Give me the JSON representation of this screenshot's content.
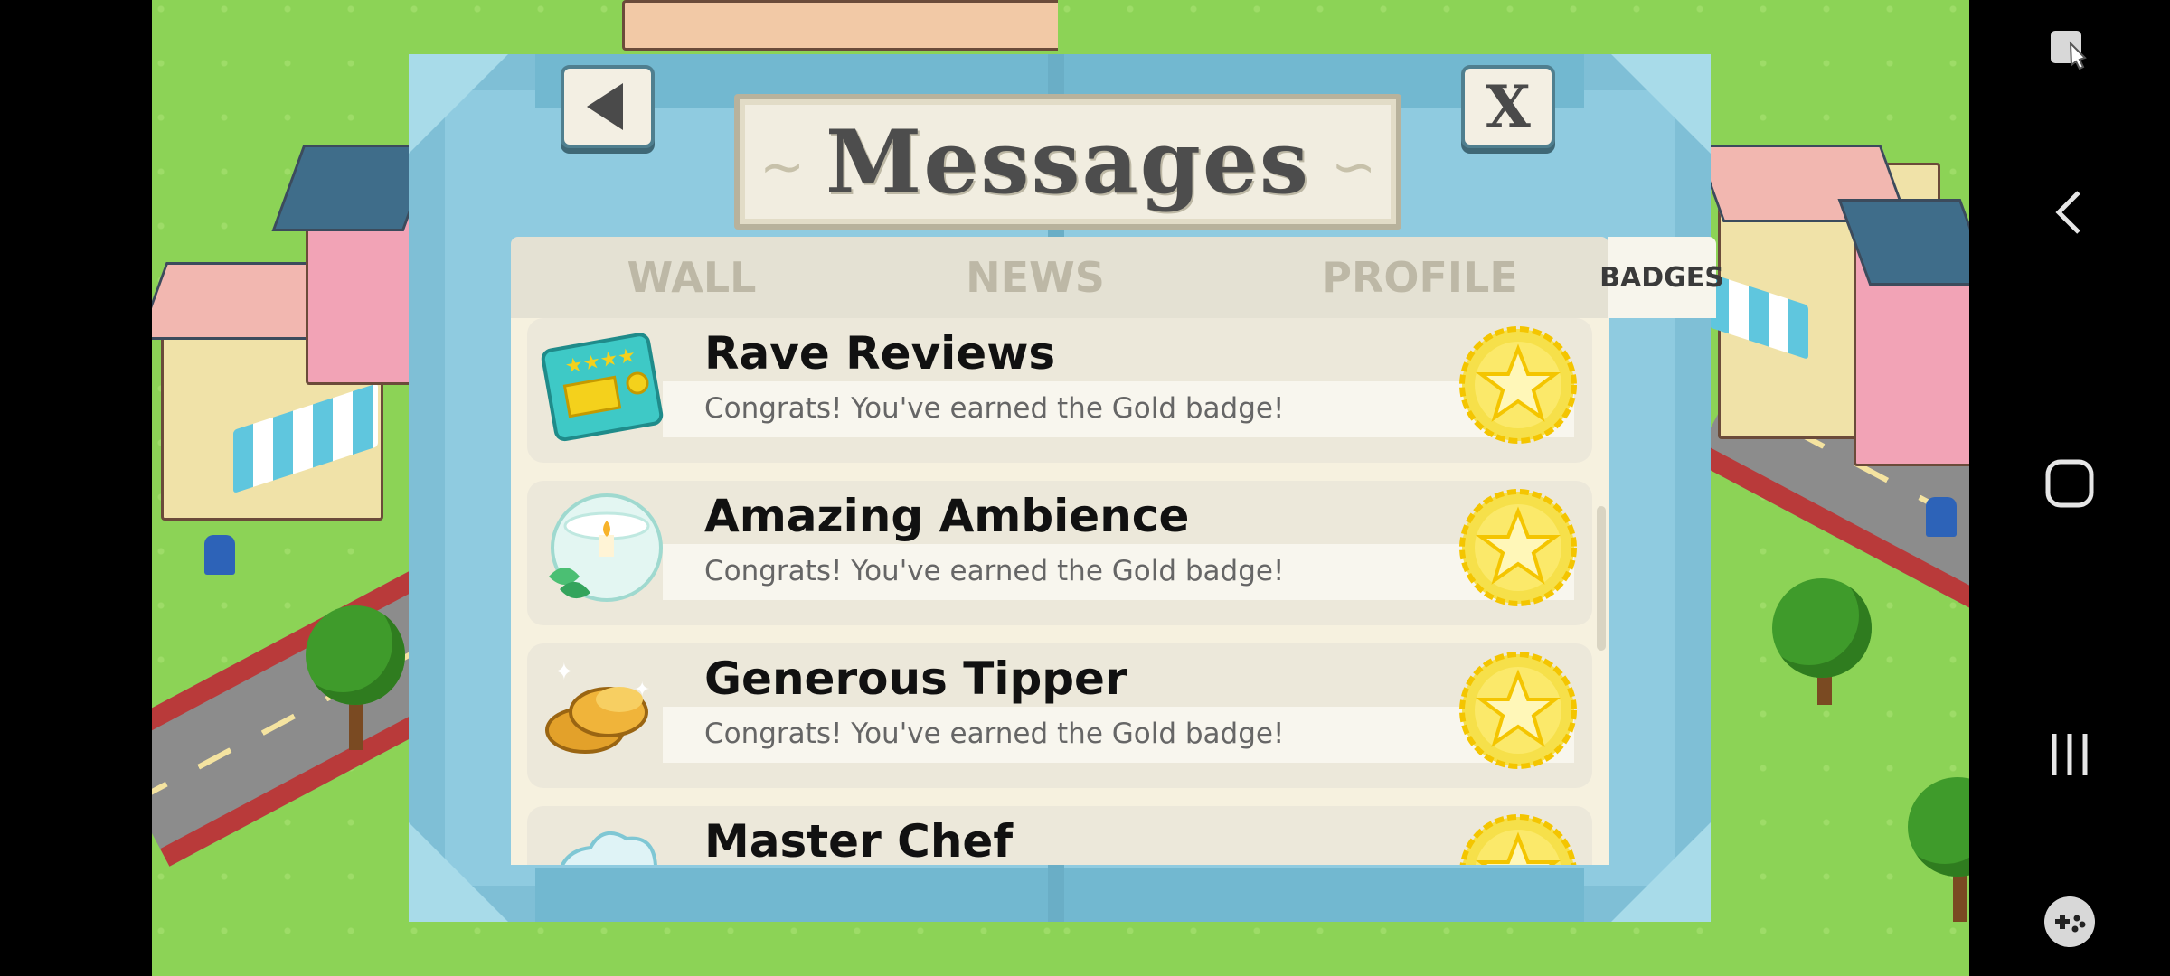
{
  "dialog": {
    "title": "Messages",
    "close_label": "X",
    "tabs": [
      {
        "label": "WALL",
        "active": false
      },
      {
        "label": "NEWS",
        "active": false
      },
      {
        "label": "PROFILE",
        "active": false
      },
      {
        "label": "BADGES",
        "active": true
      }
    ],
    "badges": [
      {
        "name": "Rave Reviews",
        "message": "Congrats! You've earned the Gold badge!",
        "icon": "review-card-icon",
        "medal": "gold-star-medal"
      },
      {
        "name": "Amazing Ambience",
        "message": "Congrats! You've earned the Gold badge!",
        "icon": "candle-bowl-icon",
        "medal": "gold-star-medal"
      },
      {
        "name": "Generous Tipper",
        "message": "Congrats! You've earned the Gold badge!",
        "icon": "gold-coins-icon",
        "medal": "gold-star-medal"
      },
      {
        "name": "Master Chef",
        "message": "",
        "icon": "chef-hat-icon",
        "medal": "gold-star-medal"
      }
    ]
  },
  "system_nav": {
    "icons": [
      "screen-record-icon",
      "back-icon",
      "home-icon",
      "recents-icon",
      "game-tools-icon"
    ]
  },
  "colors": {
    "frame": "#7fbfd6",
    "grass": "#8cd356",
    "gold": "#f4d11c"
  }
}
